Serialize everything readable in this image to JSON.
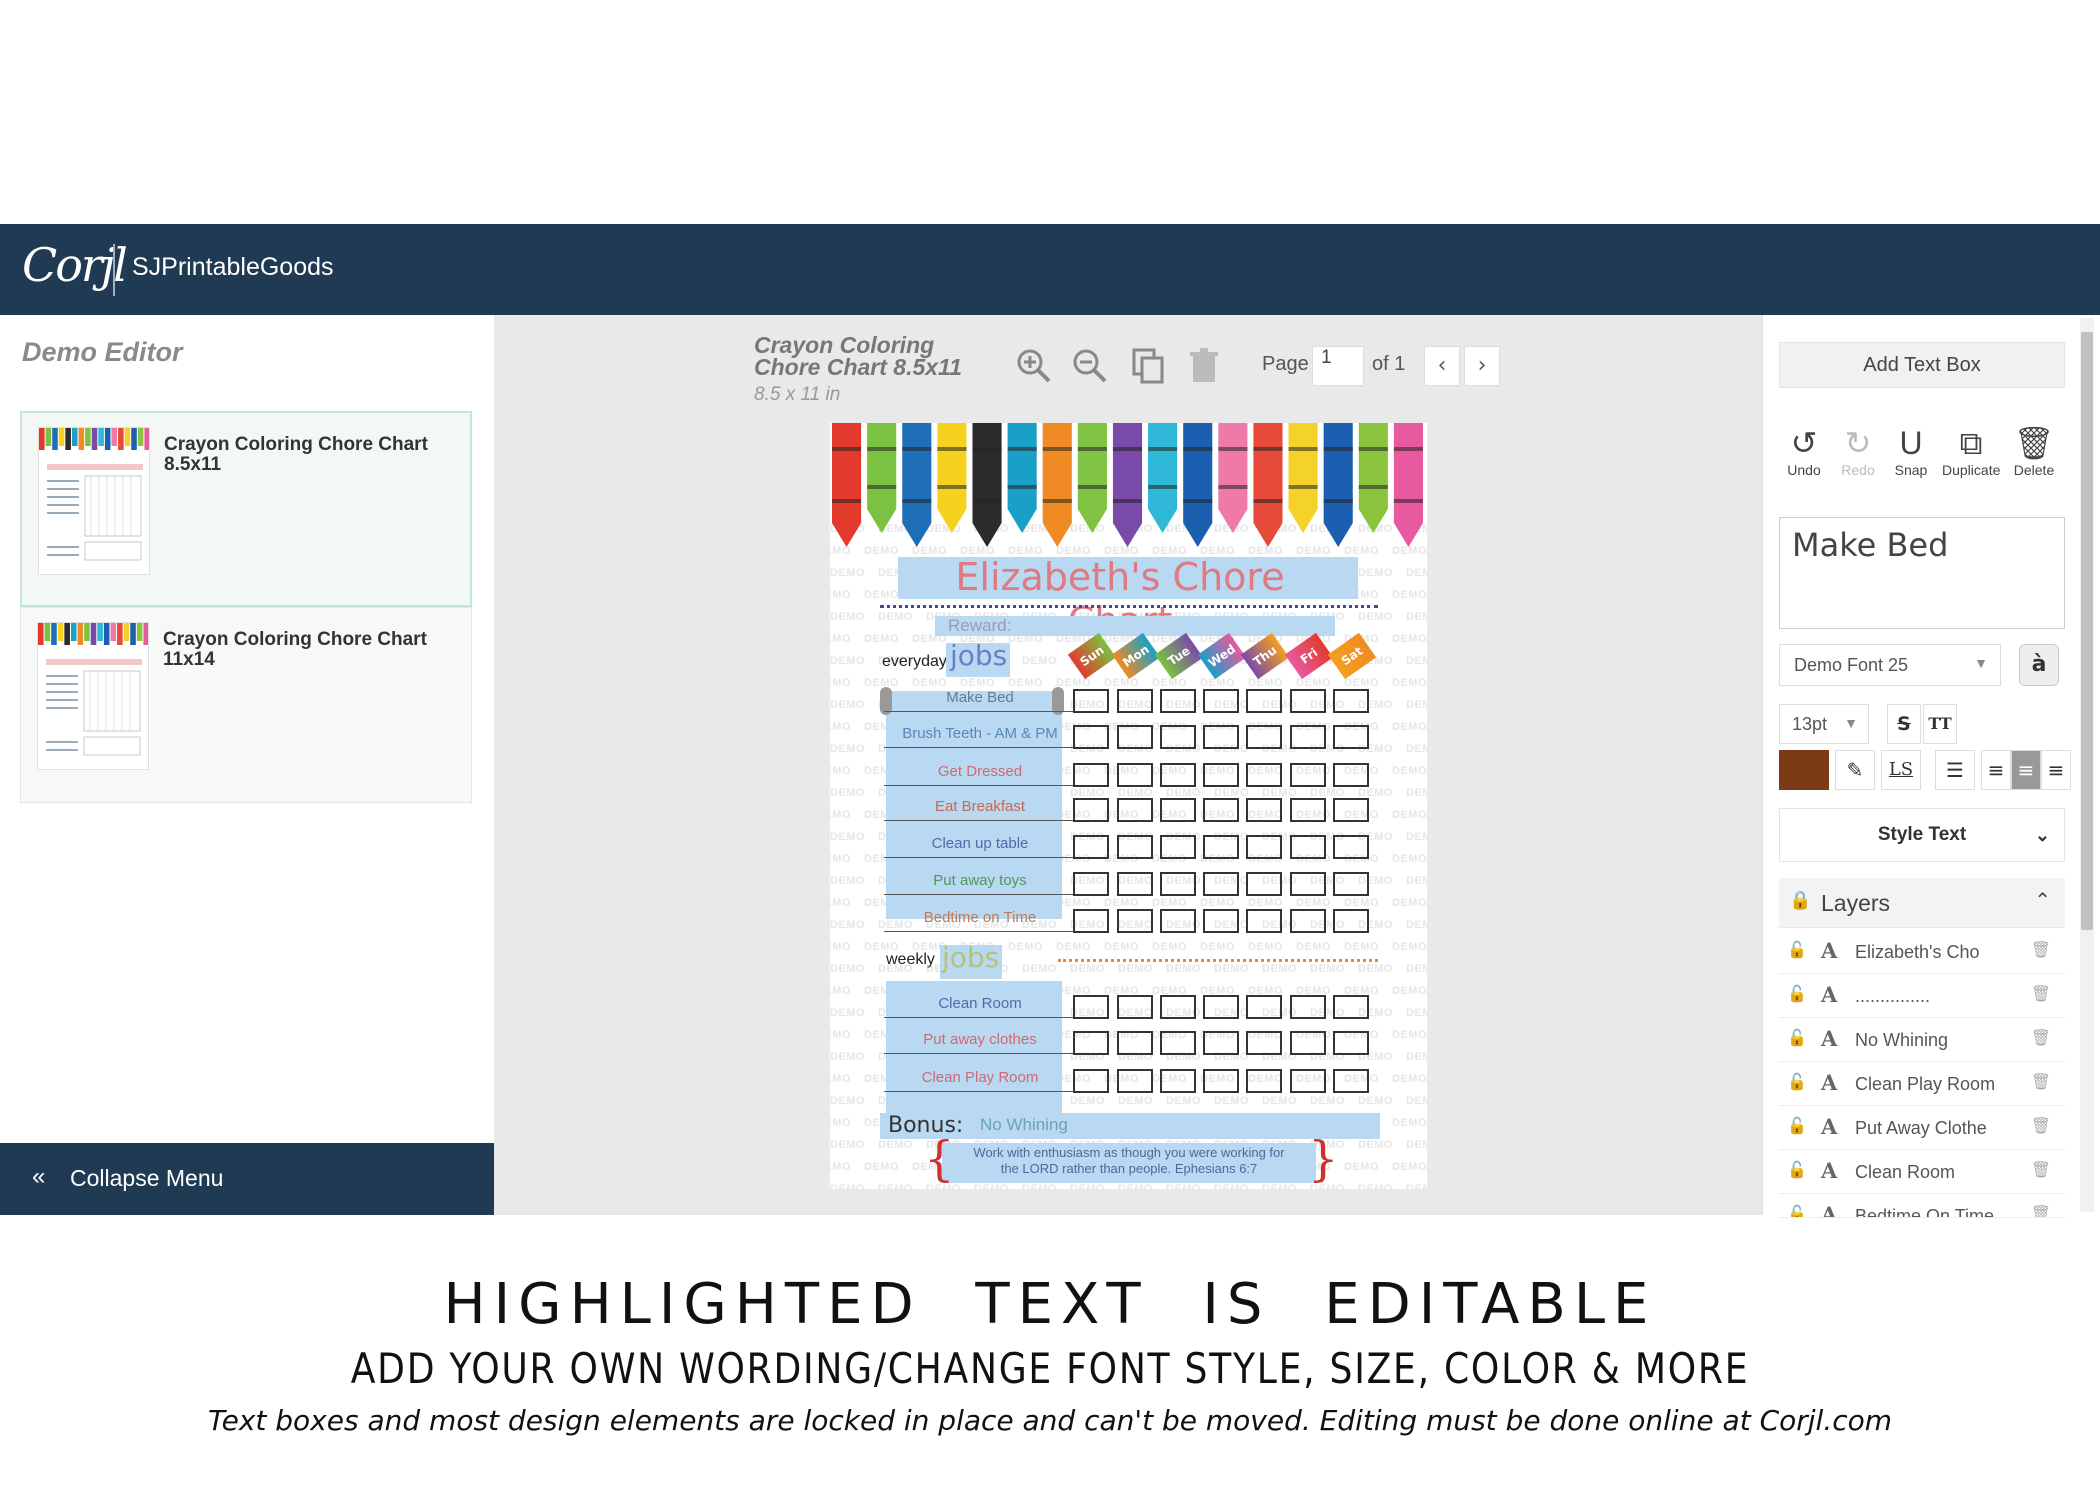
{
  "header": {
    "logo": "Corjl",
    "shop_name": "SJPrintableGoods"
  },
  "left_panel": {
    "title": "Demo Editor",
    "templates": [
      {
        "name": "Crayon Coloring Chore Chart 8.5x11",
        "selected": true
      },
      {
        "name": "Crayon Coloring Chore Chart 11x14",
        "selected": false
      }
    ],
    "collapse_label": "Collapse Menu"
  },
  "canvas_toolbar": {
    "doc_title": "Crayon Coloring Chore Chart 8.5x11",
    "doc_size": "8.5 x 11 in",
    "tools": [
      "zoom-in-icon",
      "zoom-out-icon",
      "copy-icon",
      "trash-icon"
    ],
    "page_label": "Page",
    "page_value": "1",
    "page_of": "of 1"
  },
  "chart": {
    "title": "Elizabeth's Chore Chart",
    "reward_label": "Reward:",
    "everyday_label": "everyday",
    "jobs_label": "jobs",
    "weekly_label": "weekly",
    "days": [
      "Sun",
      "Mon",
      "Tue",
      "Wed",
      "Thu",
      "Fri",
      "Sat"
    ],
    "everyday_jobs": [
      {
        "text": "Make Bed",
        "color": "#6a7a8a"
      },
      {
        "text": "Brush Teeth - AM & PM",
        "color": "#5b86b8"
      },
      {
        "text": "Get Dressed",
        "color": "#d06a70"
      },
      {
        "text": "Eat Breakfast",
        "color": "#c9684e"
      },
      {
        "text": "Clean up table",
        "color": "#5a66a8"
      },
      {
        "text": "Put away toys",
        "color": "#4c9a5a"
      },
      {
        "text": "Bedtime on Time",
        "color": "#c27a4e"
      }
    ],
    "weekly_jobs": [
      {
        "text": "Clean Room",
        "color": "#5a66a8"
      },
      {
        "text": "Put away clothes",
        "color": "#d06a70"
      },
      {
        "text": "Clean Play Room",
        "color": "#d06a70"
      }
    ],
    "bonus_label": "Bonus:",
    "bonus_value": "No Whining",
    "verse_line1": "Work with enthusiasm as though you were working for",
    "verse_line2": "the LORD rather than people. Ephesians 6:7",
    "watermark": "DEMO",
    "crayon_colors": [
      "#e23b2e",
      "#7bc142",
      "#1f6fb8",
      "#f6d21e",
      "#2b2b2b",
      "#1aa0c8",
      "#f08a24",
      "#80c342",
      "#7a4aa8",
      "#2fb8d8",
      "#1c5fb0",
      "#ef7aa8",
      "#e54a3a",
      "#f4d22a",
      "#1c5fb0",
      "#8ac43e",
      "#e85aa0"
    ]
  },
  "right_panel": {
    "add_text_box": "Add Text Box",
    "tools": [
      {
        "label": "Undo",
        "icon": "undo-icon",
        "glyph": "↺",
        "enabled": true
      },
      {
        "label": "Redo",
        "icon": "redo-icon",
        "glyph": "↻",
        "enabled": false
      },
      {
        "label": "Snap",
        "icon": "magnet-icon",
        "glyph": "U",
        "enabled": true
      },
      {
        "label": "Duplicate",
        "icon": "duplicate-icon",
        "glyph": "⧉",
        "enabled": true
      },
      {
        "label": "Delete",
        "icon": "trash-icon",
        "glyph": "🗑",
        "enabled": true
      }
    ],
    "text_value": "Make Bed",
    "font": "Demo Font 25",
    "font_size": "13pt",
    "text_color": "#7a3b16",
    "style_text": "Style Text",
    "layers_title": "Layers",
    "layers": [
      "Elizabeth's Cho",
      "...............",
      "No Whining",
      "Clean Play Room",
      "Put Away Clothe",
      "Clean Room",
      "Bedtime On Time"
    ]
  },
  "captions": {
    "line1": "HIGHLIGHTED TEXT IS EDITABLE",
    "line2": "ADD YOUR OWN WORDING/CHANGE FONT STYLE, SIZE, COLOR & MORE",
    "line3": "Text boxes and most design elements are locked in place and can't be moved. Editing must be done online at Corjl.com"
  }
}
